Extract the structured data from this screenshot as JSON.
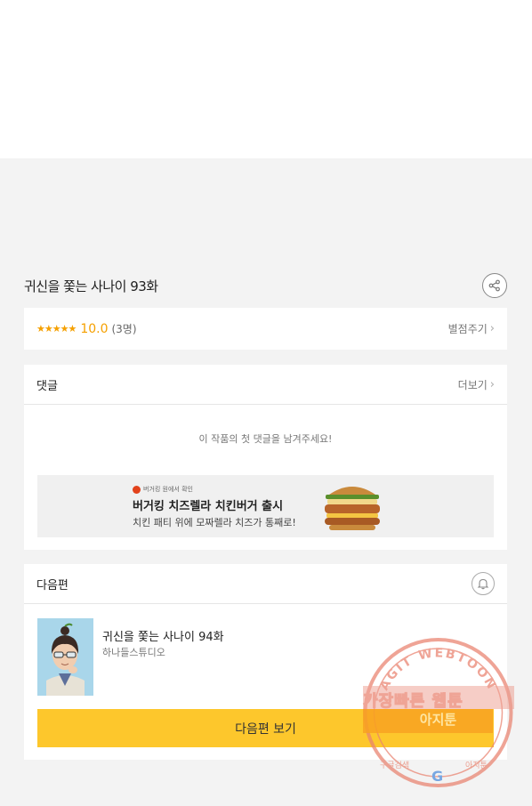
{
  "episode": {
    "title": "귀신을 쫓는 사나이 93화"
  },
  "rating": {
    "stars": "★★★★★",
    "score": "10.0",
    "count": "(3명)",
    "rate_link": "별점주기"
  },
  "comments": {
    "header": "댓글",
    "more_link": "더보기",
    "empty_message": "이 작품의 첫 댓글을 남겨주세요!"
  },
  "ad": {
    "brand": "버거킹 원에서 확인",
    "headline": "버거킹 치즈렐라 치킨버거 출시",
    "subtext": "치킨 패티 위에 모짜렐라 치즈가 통째로!"
  },
  "next": {
    "header": "다음편",
    "title": "귀신을 쫓는 사나이 94화",
    "studio": "하나들스튜디오",
    "button_label": "다음편 보기"
  },
  "watermark": {
    "ring_text": "AGIT WEBTOON",
    "top_text": "가장빠른 웹툰",
    "bottom_text": "아지툰",
    "left_small": "구글검색",
    "right_small": "아지툰"
  },
  "colors": {
    "accent_yellow": "#fdc72c",
    "star_orange": "#f5a000",
    "watermark_red": "#e9826f"
  }
}
